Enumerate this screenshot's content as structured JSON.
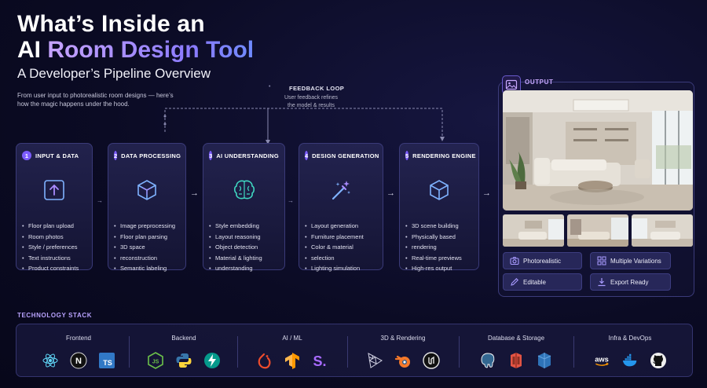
{
  "header": {
    "title_line1": "What’s Inside an",
    "title_line2_prefix": "AI",
    "title_line2_accent": "Room Design Tool",
    "subtitle": "A Developer’s Pipeline Overview",
    "intro": "From user input to photorealistic room designs — here’s how the magic happens under the hood."
  },
  "feedback_loop": {
    "title": "FEEDBACK LOOP",
    "description": "User feedback refines the model & results"
  },
  "steps": [
    {
      "num": "1",
      "title": "INPUT & DATA",
      "icon": "upload-icon",
      "items": [
        "Floor plan upload",
        "Room photos",
        "Style / preferences",
        "Text instructions",
        "Product constraints"
      ]
    },
    {
      "num": "2",
      "title": "DATA PROCESSING",
      "icon": "cube-icon",
      "items": [
        "Image preprocessing",
        "Floor plan parsing",
        "3D space",
        "reconstruction",
        "Semantic labeling"
      ]
    },
    {
      "num": "3",
      "title": "AI UNDERSTANDING",
      "icon": "brain-icon",
      "items": [
        "Style embedding",
        "Layout reasoning",
        "Object detection",
        "Material & lighting",
        "understanding"
      ]
    },
    {
      "num": "4",
      "title": "DESIGN GENERATION",
      "icon": "magic-wand-icon",
      "items": [
        "Layout generation",
        "Furniture placement",
        "Color & material",
        "selection",
        "Lighting simulation"
      ]
    },
    {
      "num": "5",
      "title": "RENDERING ENGINE",
      "icon": "cube-icon",
      "items": [
        "3D scene building",
        "Physically based",
        "rendering",
        "Real-time previews",
        "High-res output"
      ]
    }
  ],
  "output": {
    "label": "OUTPUT",
    "features": [
      {
        "label": "Photorealistic",
        "icon": "camera-icon"
      },
      {
        "label": "Multiple Variations",
        "icon": "grid-icon"
      },
      {
        "label": "Editable",
        "icon": "pencil-icon"
      },
      {
        "label": "Export Ready",
        "icon": "download-icon"
      }
    ]
  },
  "tech_stack": {
    "label": "TECHNOLOGY STACK",
    "groups": [
      {
        "name": "Frontend",
        "icons": [
          "react-icon",
          "nextjs-icon",
          "typescript-icon"
        ]
      },
      {
        "name": "Backend",
        "icons": [
          "nodejs-icon",
          "python-icon",
          "fastapi-icon"
        ]
      },
      {
        "name": "AI / ML",
        "icons": [
          "pytorch-icon",
          "tensorflow-icon",
          "stability-icon"
        ]
      },
      {
        "name": "3D & Rendering",
        "icons": [
          "threejs-icon",
          "blender-icon",
          "unreal-icon"
        ]
      },
      {
        "name": "Database & Storage",
        "icons": [
          "postgresql-icon",
          "aws-s3-icon",
          "dynamodb-icon"
        ]
      },
      {
        "name": "Infra & DevOps",
        "icons": [
          "aws-icon",
          "docker-icon",
          "github-icon"
        ]
      }
    ],
    "text_glyphs": {
      "nextjs": "N",
      "typescript": "TS",
      "nodejs": "JS",
      "stability": "S.",
      "aws": "aws"
    }
  },
  "colors": {
    "accent": "#7c5cff",
    "output_label": "#c9a9ff",
    "icon_stroke": "#7fb2ff",
    "background": "#0b0b24"
  }
}
